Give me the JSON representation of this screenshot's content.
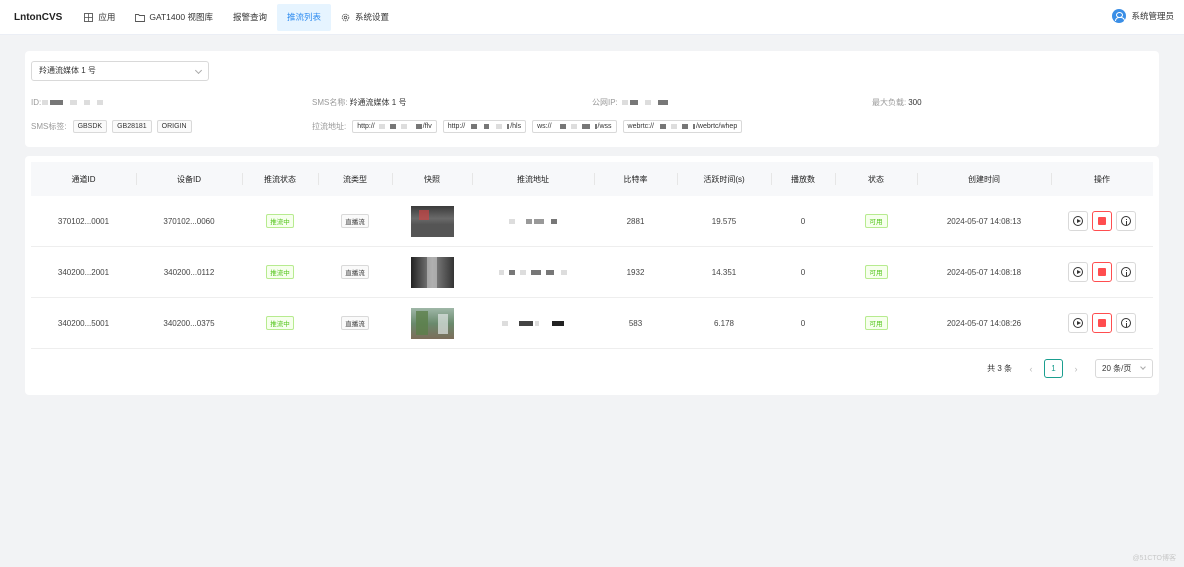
{
  "app": {
    "brand": "LntonCVS"
  },
  "nav": {
    "items": [
      {
        "label": "应用",
        "icon": "grid-icon"
      },
      {
        "label": "GAT1400 视图库",
        "icon": "folder-icon"
      },
      {
        "label": "报警查询",
        "icon": ""
      },
      {
        "label": "推流列表",
        "icon": "",
        "active": true
      },
      {
        "label": "系统设置",
        "icon": "gear-icon"
      }
    ]
  },
  "user": {
    "name": "系统管理员"
  },
  "sms": {
    "selected": "羚通流媒体 1 号",
    "id_label": "ID:",
    "name_label": "SMS名称:",
    "name_value": "羚通流媒体 1 号",
    "ip_label": "公网IP:",
    "load_label": "最大负载:",
    "load_value": "300",
    "tags_label": "SMS标签:",
    "tags": [
      "GBSDK",
      "GB28181",
      "ORIGIN"
    ],
    "pull_label": "拉流地址:",
    "urls": [
      {
        "prefix": "http://",
        "suffix": "/flv"
      },
      {
        "prefix": "http://",
        "suffix": "/hls"
      },
      {
        "prefix": "ws://",
        "suffix": "/wss"
      },
      {
        "prefix": "webrtc://",
        "suffix": "/webrtc/whep"
      }
    ]
  },
  "table": {
    "headers": [
      "通道ID",
      "设备ID",
      "推流状态",
      "流类型",
      "快照",
      "推流地址",
      "比特率",
      "活跃时间(s)",
      "播放数",
      "状态",
      "创建时间",
      "操作"
    ],
    "rows": [
      {
        "channel_id": "370102...0001",
        "device_id": "370102...0060",
        "push_status": "推流中",
        "stream_type": "直播流",
        "bitrate": "2881",
        "active_time": "19.575",
        "play_count": "0",
        "status": "可用",
        "created": "2024-05-07 14:08:13"
      },
      {
        "channel_id": "340200...2001",
        "device_id": "340200...0112",
        "push_status": "推流中",
        "stream_type": "直播流",
        "bitrate": "1932",
        "active_time": "14.351",
        "play_count": "0",
        "status": "可用",
        "created": "2024-05-07 14:08:18"
      },
      {
        "channel_id": "340200...5001",
        "device_id": "340200...0375",
        "push_status": "推流中",
        "stream_type": "直播流",
        "bitrate": "583",
        "active_time": "6.178",
        "play_count": "0",
        "status": "可用",
        "created": "2024-05-07 14:08:26"
      }
    ]
  },
  "pagination": {
    "total": "共 3 条",
    "current": "1",
    "page_size": "20 条/页"
  },
  "watermark": "@51CTO博客"
}
